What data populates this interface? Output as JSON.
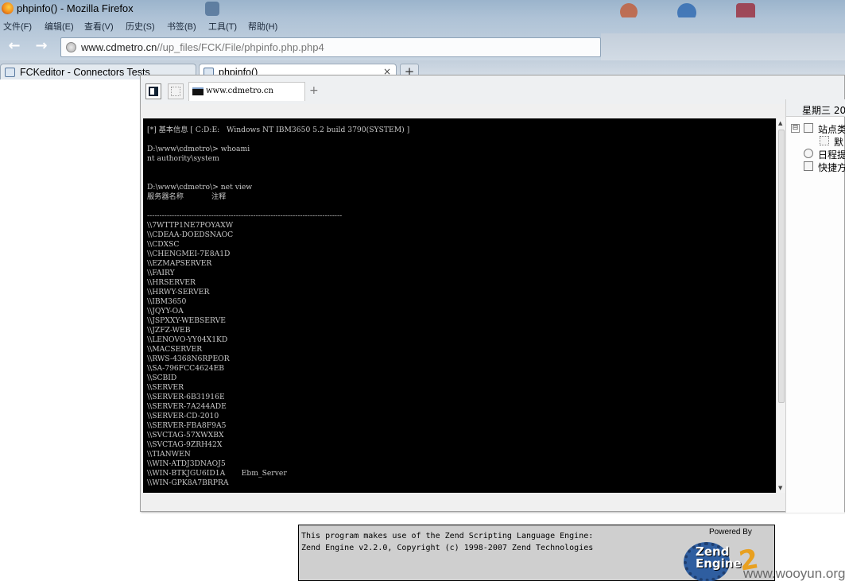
{
  "window": {
    "title": "phpinfo() - Mozilla Firefox",
    "menu": [
      "文件(F)",
      "编辑(E)",
      "查看(V)",
      "历史(S)",
      "书签(B)",
      "工具(T)",
      "帮助(H)"
    ]
  },
  "navigation": {
    "url_domain": "www.cdmetro.cn",
    "url_path": "//up_files/FCK/File/phpinfo.php.php4"
  },
  "browser_tabs": [
    {
      "label": "FCKeditor - Connectors Tests"
    },
    {
      "label": "phpinfo()",
      "close": "×"
    }
  ],
  "new_tab_symbol": "+",
  "tool_window": {
    "tab_label": "www.cdmetro.cn",
    "plus": "+",
    "side_panel": {
      "date_label": "星期三 20",
      "tree": [
        {
          "toggle": "⊟",
          "label": "站点类"
        },
        {
          "label": "默"
        },
        {
          "label": "日程提"
        },
        {
          "label": "快捷方"
        }
      ]
    },
    "terminal_lines": [
      "[*] 基本信息 [ C:D:E:   Windows NT IBM3650 5.2 build 3790(SYSTEM) ]",
      "",
      "D:\\www\\cdmetro\\> whoami",
      "nt authority\\system",
      "",
      "",
      "D:\\www\\cdmetro\\> net view",
      "服务器名称            注释",
      "",
      "-------------------------------------------------------------------------------",
      "\\\\7WTTP1NE7POYAXW",
      "\\\\CDEAA-DOEDSNAOC",
      "\\\\CDXSC",
      "\\\\CHENGMEI-7E8A1D",
      "\\\\EZMAPSERVER",
      "\\\\FAIRY",
      "\\\\HRSERVER",
      "\\\\HRWY-SERVER",
      "\\\\IBM3650",
      "\\\\JQYY-OA",
      "\\\\JSPXXY-WEBSERVE",
      "\\\\JZFZ-WEB",
      "\\\\LENOVO-YY04X1KD",
      "\\\\MACSERVER",
      "\\\\RWS-4368N6RPEOR",
      "\\\\SA-796FCC4624EB",
      "\\\\SCBID",
      "\\\\SERVER",
      "\\\\SERVER-6B31916E",
      "\\\\SERVER-7A244ADE",
      "\\\\SERVER-CD-2010",
      "\\\\SERVER-FBA8F9A5",
      "\\\\SVCTAG-57XWXBX",
      "\\\\SVCTAG-9ZRH42X",
      "\\\\TIANWEN",
      "\\\\WIN-ATDJ3DNAOJ5",
      "\\\\WIN-BTKJGU6ID1A       Ebm_Server",
      "\\\\WIN-GPK8A7BRPRA"
    ]
  },
  "zend": {
    "line1": "This program makes use of the Zend Scripting Language Engine:",
    "line2": "Zend Engine v2.2.0, Copyright (c) 1998-2007 Zend Technologies",
    "powered_by": "Powered By",
    "logo_text": "Zend\nEngine",
    "logo_number": "2"
  },
  "watermark": "www.wooyun.org"
}
